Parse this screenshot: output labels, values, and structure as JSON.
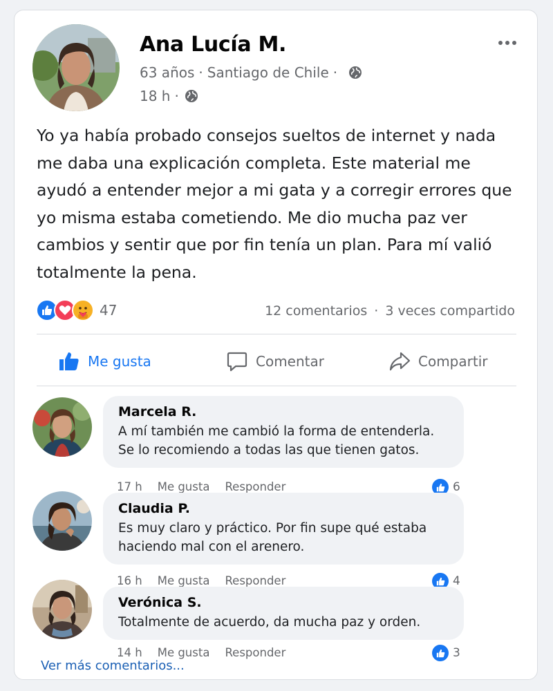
{
  "post": {
    "author": "Ana Lucía M.",
    "age": "63 años",
    "location": "Santiago de Chile",
    "time": "18 h",
    "text": "Yo ya había probado consejos sueltos de internet y nada me daba una explicación completa. Este material me ayudó a entender mejor a mi gata y a corregir errores que yo misma estaba cometiendo. Me dio mucha paz ver cambios y sentir que por fin tenía un plan. Para mí valió totalmente la pena.",
    "reactions_count": "47",
    "comments_count": "12 comentarios",
    "shares_count": "3 veces compartido",
    "separator": "·"
  },
  "actions": {
    "like": "Me gusta",
    "comment": "Comentar",
    "share": "Compartir"
  },
  "comments": [
    {
      "name": "Marcela R.",
      "text": "A mí también me cambió la forma de entenderla. Se lo recomiendo a todas las que tienen gatos.",
      "time": "17 h",
      "like": "Me gusta",
      "reply": "Responder",
      "likes": "6"
    },
    {
      "name": "Claudia P.",
      "text": "Es muy claro y práctico. Por fin supe qué estaba haciendo mal con el arenero.",
      "time": "16 h",
      "like": "Me gusta",
      "reply": "Responder",
      "likes": "4"
    },
    {
      "name": "Verónica S.",
      "text": "Totalmente de acuerdo, da mucha paz y orden.",
      "time": "14 h",
      "like": "Me gusta",
      "reply": "Responder",
      "likes": "3"
    }
  ],
  "see_more": "Ver más comentarios...",
  "colors": {
    "accent": "#1877f2",
    "love": "#f33e58",
    "care": "#f7b125",
    "muted": "#65676b"
  },
  "icons": [
    "more-options-icon",
    "globe-icon",
    "like-reaction-icon",
    "love-reaction-icon",
    "care-reaction-icon",
    "thumbs-up-icon",
    "comment-icon",
    "share-icon"
  ]
}
